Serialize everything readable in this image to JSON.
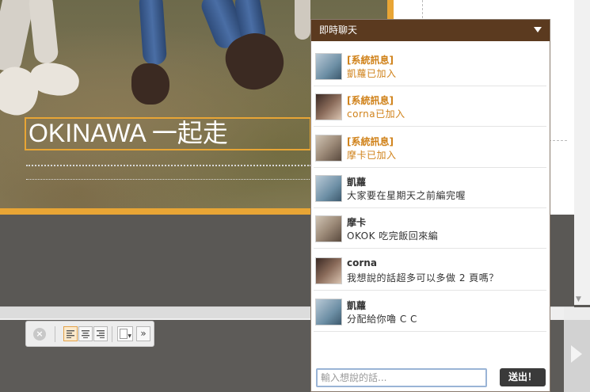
{
  "title_box": {
    "text": "OKINAWA 一起走"
  },
  "chat": {
    "header_title": "即時聊天",
    "messages": [
      {
        "sender": "[系統訊息]",
        "text": "凱蘿已加入",
        "system": true,
        "avatar": "avatar-photo-1"
      },
      {
        "sender": "[系統訊息]",
        "text": "corna已加入",
        "system": true,
        "avatar": "avatar-photo-2"
      },
      {
        "sender": "[系統訊息]",
        "text": "摩卡已加入",
        "system": true,
        "avatar": "avatar-photo-3"
      },
      {
        "sender": "凱蘿",
        "text": "大家要在星期天之前編完喔",
        "system": false,
        "avatar": "avatar-photo-1"
      },
      {
        "sender": "摩卡",
        "text": "OKOK 吃完飯回來編",
        "system": false,
        "avatar": "avatar-photo-3"
      },
      {
        "sender": "corna",
        "text": "我想說的話超多可以多做 2 頁嗎？",
        "system": false,
        "avatar": "avatar-photo-2"
      },
      {
        "sender": "凱蘿",
        "text": "分配給你嚕 C C",
        "system": false,
        "avatar": "avatar-photo-1"
      }
    ],
    "input_placeholder": "輸入想說的話...",
    "send_label": "送出！"
  },
  "toolbar": {
    "close_icon": "×",
    "align_left_icon": "≡",
    "align_center_icon": "≡",
    "align_right_icon": "≡",
    "more_icon": "»"
  },
  "colors": {
    "accent_orange": "#e8a535",
    "chat_header": "#5b3a1f",
    "system_message": "#d0821a"
  }
}
